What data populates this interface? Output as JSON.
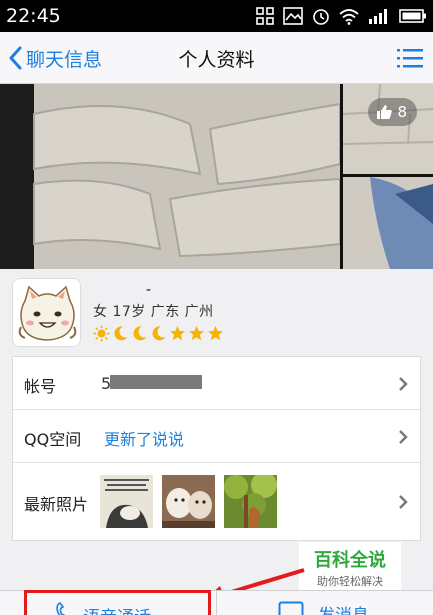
{
  "status_bar": {
    "time": "22:45"
  },
  "nav": {
    "back_label": "聊天信息",
    "title": "个人资料"
  },
  "banner": {
    "like_count": "8"
  },
  "profile": {
    "nickname": "-",
    "meta": "女 17岁 广东 广州"
  },
  "info": {
    "account_label": "帐号",
    "account_value": "5",
    "qzone_label": "QQ空间",
    "qzone_value": "更新了说说",
    "photos_label": "最新照片"
  },
  "watermark": {
    "title": "百科全说",
    "subtitle": "助你轻松解决"
  },
  "toolbar": {
    "voice_label": "语音通话",
    "message_label": "发消息"
  },
  "colors": {
    "accent": "#1d7fe0",
    "highlight": "#e21b1b",
    "watermark_green": "#2eaa3c"
  }
}
